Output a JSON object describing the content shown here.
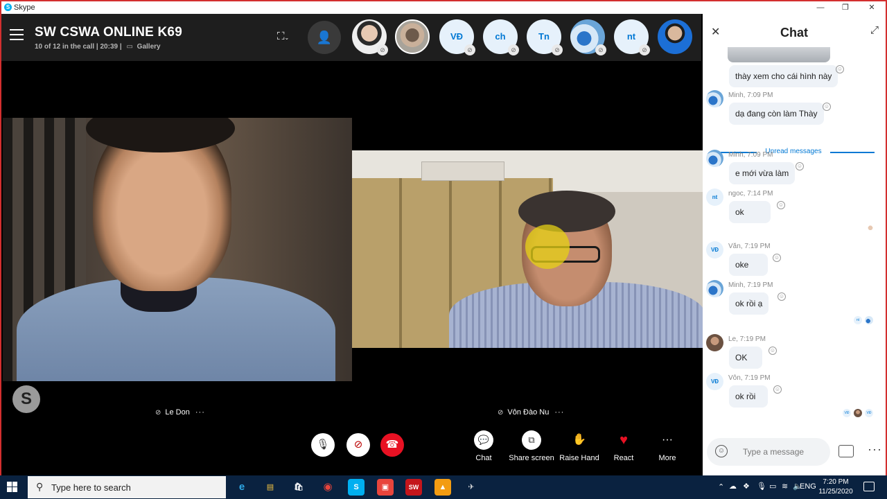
{
  "window": {
    "title": "Skype",
    "logo_letter": "S",
    "min": "—",
    "max": "❐",
    "close": "✕"
  },
  "call": {
    "title": "SW CSWA ONLINE K69",
    "status": "10 of 12 in the call | 20:39 |",
    "view_mode": "Gallery",
    "participants": [
      {
        "initials": "",
        "kind": "photo1"
      },
      {
        "initials": "",
        "kind": "photo2"
      },
      {
        "initials": "VĐ",
        "kind": "init"
      },
      {
        "initials": "ch",
        "kind": "init"
      },
      {
        "initials": "Tn",
        "kind": "init"
      },
      {
        "initials": "",
        "kind": "photo3"
      },
      {
        "initials": "nt",
        "kind": "init"
      },
      {
        "initials": "",
        "kind": "photo4"
      }
    ],
    "tiles": [
      {
        "name": "Le Don",
        "more": "···"
      },
      {
        "name": "Vôn Đào Nu",
        "more": "···"
      }
    ],
    "skype_badge": "S",
    "controls": {
      "mic": "🎙",
      "cam": "⊘",
      "end": "☎"
    },
    "actions": [
      {
        "label": "Chat",
        "icon": "💬"
      },
      {
        "label": "Share screen",
        "icon": "⧉"
      },
      {
        "label": "Raise Hand",
        "icon": "✋"
      },
      {
        "label": "React",
        "icon": "♥"
      },
      {
        "label": "More",
        "icon": "···"
      }
    ]
  },
  "chat": {
    "title": "Chat",
    "close": "✕",
    "expand": "⤢",
    "unread_label": "Unread messages",
    "messages": [
      {
        "sender": "",
        "time": "",
        "text": "thày xem cho cái hình này"
      },
      {
        "sender": "Minh, 7:09 PM",
        "text": "dạ đang còn làm Thày",
        "avatar": "blue"
      },
      {
        "sender": "Minh, 7:09 PM",
        "text": "e mới vừa làm",
        "avatar": "blue"
      },
      {
        "sender": "ngoc, 7:14 PM",
        "text": "ok",
        "avatar": "init",
        "initials": "nt"
      },
      {
        "sender": "Văn, 7:19 PM",
        "text": "oke",
        "avatar": "init",
        "initials": "VĐ"
      },
      {
        "sender": "Minh, 7:19 PM",
        "text": "ok rồi ạ",
        "avatar": "blue"
      },
      {
        "sender": "Le, 7:19 PM",
        "text": "OK",
        "avatar": "photo"
      },
      {
        "sender": "Vôn, 7:19 PM",
        "text": "ok rồi",
        "avatar": "init",
        "initials": "VĐ"
      }
    ],
    "composer_placeholder": "Type a message",
    "emoji": "☺",
    "more": "···"
  },
  "taskbar": {
    "search_text": "Type here to search",
    "search_icon": "⚲",
    "apps": [
      "e",
      "▤",
      "🛍",
      "◉",
      "S",
      "▣",
      "SW",
      "▲",
      "✈"
    ],
    "tray_lang": "ENG",
    "time": "7:20 PM",
    "date": "11/25/2020"
  }
}
